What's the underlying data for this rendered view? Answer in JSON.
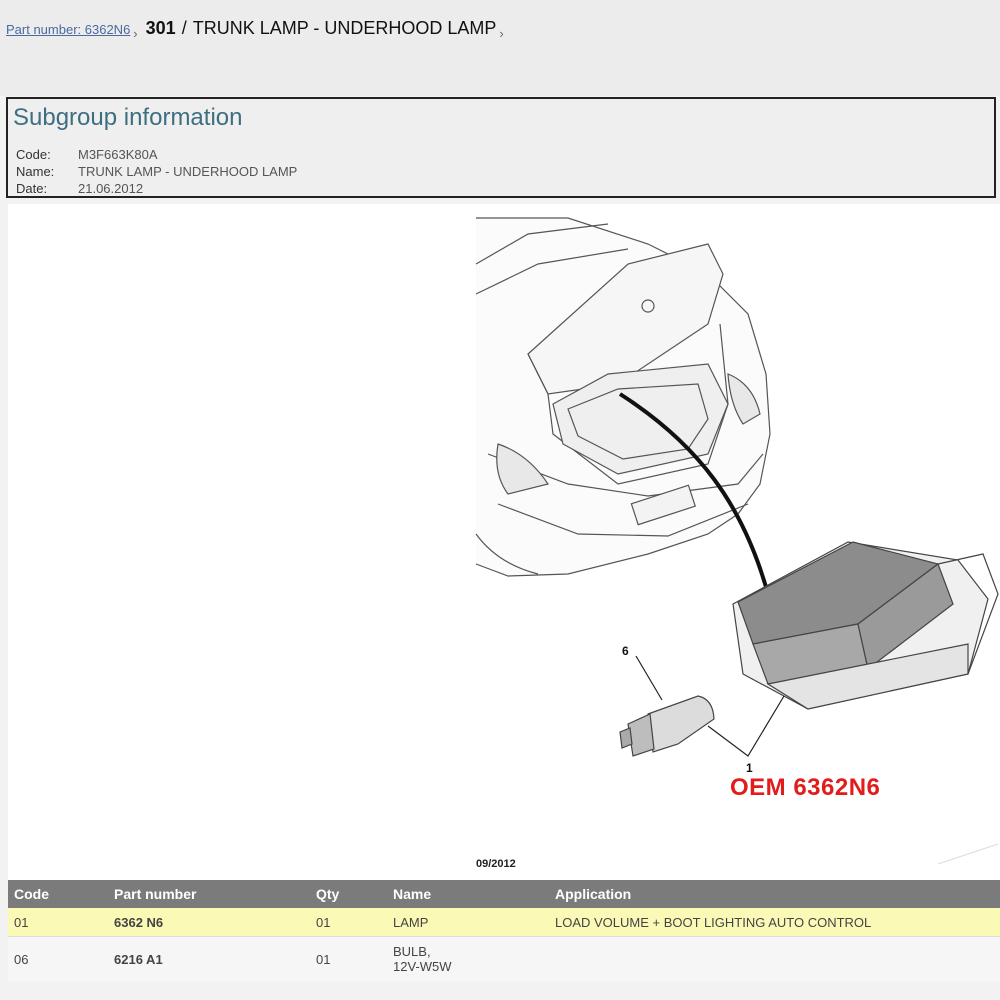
{
  "breadcrumb": {
    "part_link": "Part number: 6362N6",
    "chevron": "›",
    "model": "301",
    "separator": "/",
    "title": "TRUNK LAMP - UNDERHOOD LAMP",
    "chevron_end": "›"
  },
  "subgroup": {
    "heading": "Subgroup information",
    "code_label": "Code:",
    "code_value": "M3F663K80A",
    "name_label": "Name:",
    "name_value": "TRUNK LAMP - UNDERHOOD LAMP",
    "date_label": "Date:",
    "date_value": "21.06.2012"
  },
  "diagram": {
    "callout_6": "6",
    "callout_1": "1",
    "oem_label": "OEM 6362N6",
    "date_stamp": "09/2012",
    "oem_color": "#e21b1b"
  },
  "table": {
    "headers": [
      "Code",
      "Part number",
      "Qty",
      "Name",
      "Application"
    ],
    "rows": [
      {
        "code": "01",
        "part": "6362 N6",
        "qty": "01",
        "name": "LAMP",
        "application": "LOAD VOLUME + BOOT LIGHTING AUTO CONTROL"
      },
      {
        "code": "06",
        "part": "6216 A1",
        "qty": "01",
        "name": "BULB,",
        "name2": "12V-W5W",
        "application": ""
      }
    ]
  }
}
